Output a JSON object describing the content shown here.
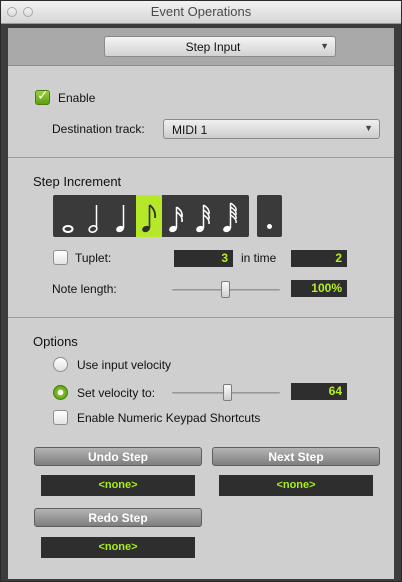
{
  "window": {
    "title": "Event Operations"
  },
  "operation_popup": {
    "value": "Step Input"
  },
  "enable": {
    "label": "Enable",
    "checked": true
  },
  "destination": {
    "label": "Destination track:",
    "value": "MIDI 1"
  },
  "step_increment": {
    "heading": "Step Increment",
    "notes": [
      {
        "name": "whole-note",
        "selected": false
      },
      {
        "name": "half-note",
        "selected": false
      },
      {
        "name": "quarter-note",
        "selected": false
      },
      {
        "name": "eighth-note",
        "selected": true
      },
      {
        "name": "sixteenth-note",
        "selected": false
      },
      {
        "name": "thirty-second-note",
        "selected": false
      },
      {
        "name": "sixty-fourth-note",
        "selected": false
      }
    ],
    "dotted": false,
    "tuplet": {
      "label": "Tuplet:",
      "checked": false,
      "value": "3",
      "in_time_label": "in time",
      "in_time_value": "2"
    },
    "note_length": {
      "label": "Note length:",
      "value": "100%"
    }
  },
  "options": {
    "heading": "Options",
    "use_input_velocity": {
      "label": "Use input velocity",
      "selected": false
    },
    "set_velocity": {
      "label": "Set velocity to:",
      "selected": true,
      "value": "64"
    },
    "numeric_keypad": {
      "label": "Enable Numeric Keypad Shortcuts",
      "checked": false
    }
  },
  "steps": {
    "undo_label": "Undo Step",
    "undo_value": "<none>",
    "next_label": "Next Step",
    "next_value": "<none>",
    "redo_label": "Redo Step",
    "redo_value": "<none>"
  },
  "colors": {
    "accent": "#b6e82a",
    "field_text": "#b6f01c",
    "field_bg": "#2e2e2e"
  }
}
